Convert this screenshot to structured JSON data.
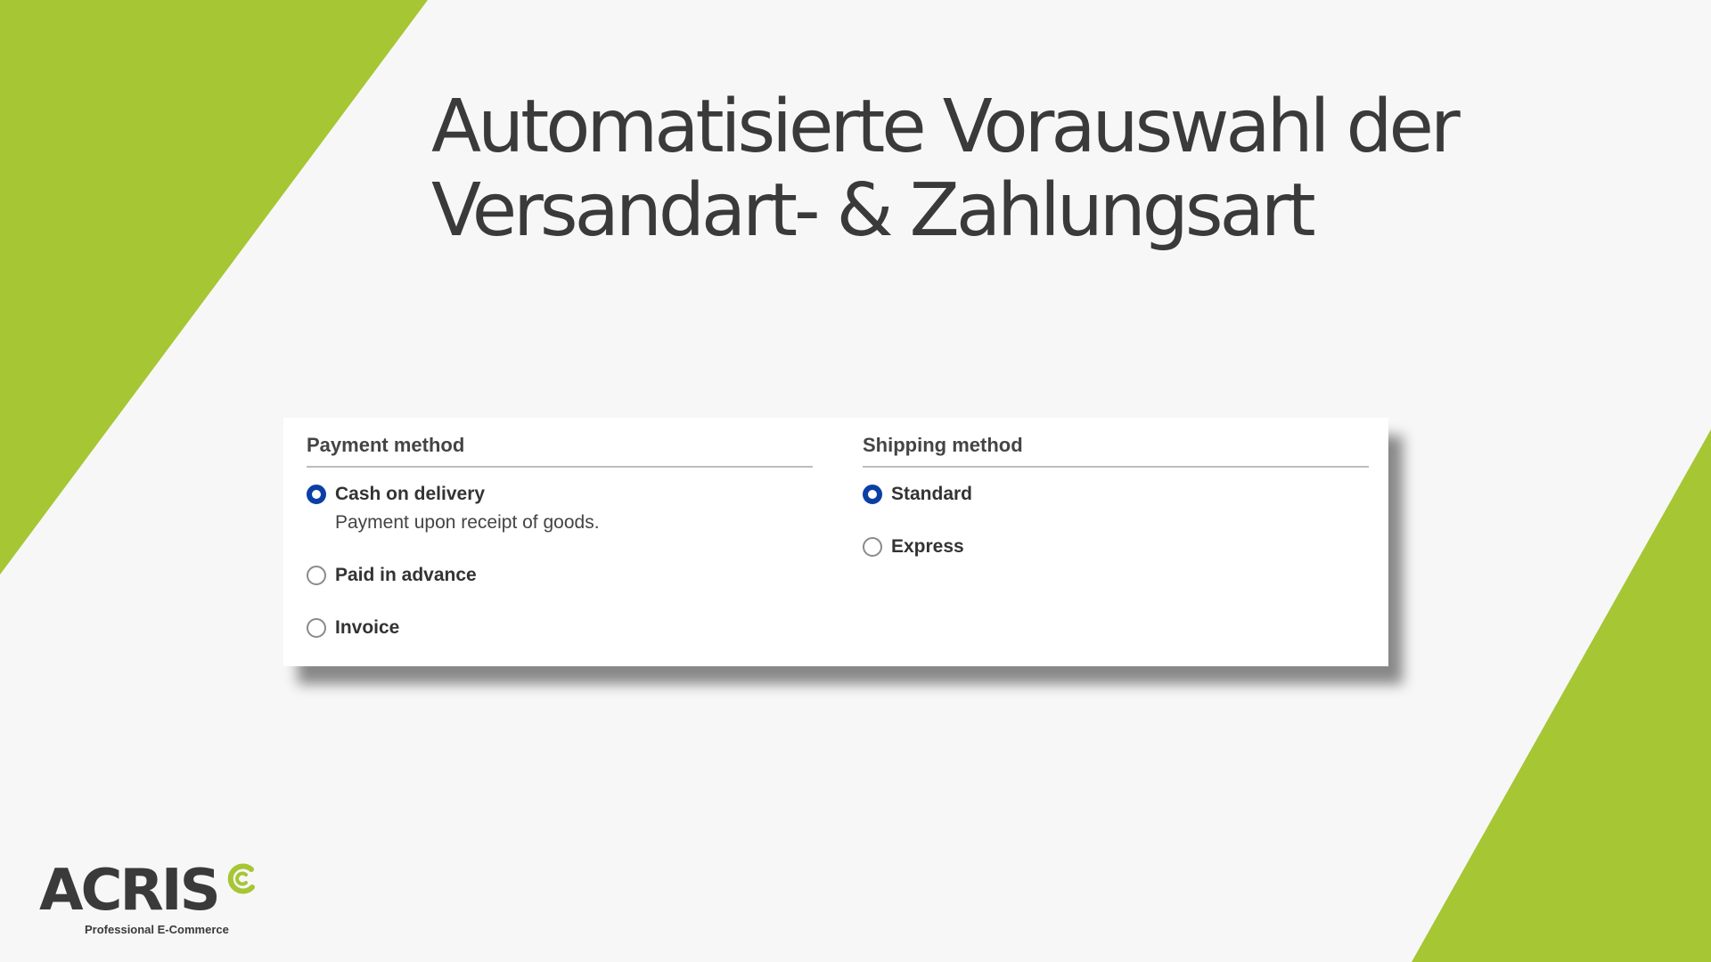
{
  "headline": {
    "line1": "Automatisierte Vorauswahl der",
    "line2": "Versandart- & Zahlungsart"
  },
  "payment": {
    "title": "Payment method",
    "options": [
      {
        "label": "Cash on delivery",
        "description": "Payment upon receipt of goods.",
        "selected": true
      },
      {
        "label": "Paid in advance",
        "selected": false
      },
      {
        "label": "Invoice",
        "selected": false
      }
    ]
  },
  "shipping": {
    "title": "Shipping method",
    "options": [
      {
        "label": "Standard",
        "selected": true
      },
      {
        "label": "Express",
        "selected": false
      }
    ]
  },
  "logo": {
    "wordmark": "ACRIS",
    "tagline": "Professional E-Commerce"
  },
  "colors": {
    "accent_green": "#a6c634",
    "radio_selected": "#0b3fa6",
    "headline_text": "#3a3a3a",
    "background": "#f7f7f7"
  },
  "icons": {
    "logo_mark": "acris-c-mark-icon",
    "radio": "radio-icon"
  }
}
